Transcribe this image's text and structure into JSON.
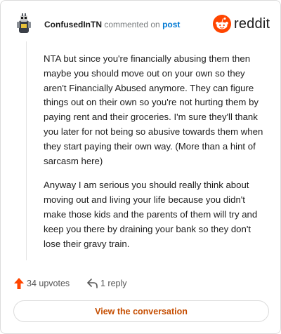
{
  "header": {
    "username": "ConfusedInTN",
    "verb": "commented on",
    "post_link": "post",
    "brand_wordmark": "reddit",
    "brand_icon": "reddit-alien-icon",
    "avatar": "user-avatar-icon"
  },
  "comment": {
    "paragraphs": [
      "NTA but since you're financially abusing them then maybe you should move out on your own so they aren't Financially Abused anymore. They can figure things out on their own so you're not hurting them by paying rent and their groceries. I'm sure they'll thank you later for not being so abusive towards them when they start paying their own way. (More than a hint of sarcasm here)",
      "Anyway I am serious you should really think about moving out and living your life because you didn't make those kids and the parents of them will try and keep you there by draining your bank so they don't lose their gravy train."
    ]
  },
  "actions": {
    "upvotes_label": "34 upvotes",
    "upvote_icon": "upvote-arrow-icon",
    "replies_label": "1 reply",
    "reply_icon": "reply-arrow-icon"
  },
  "cta": {
    "view_conversation_label": "View the conversation"
  },
  "colors": {
    "brand_orange": "#ff4500",
    "link_blue": "#0079d3",
    "cta_text": "#c54d00",
    "border": "#dcdcdc"
  }
}
